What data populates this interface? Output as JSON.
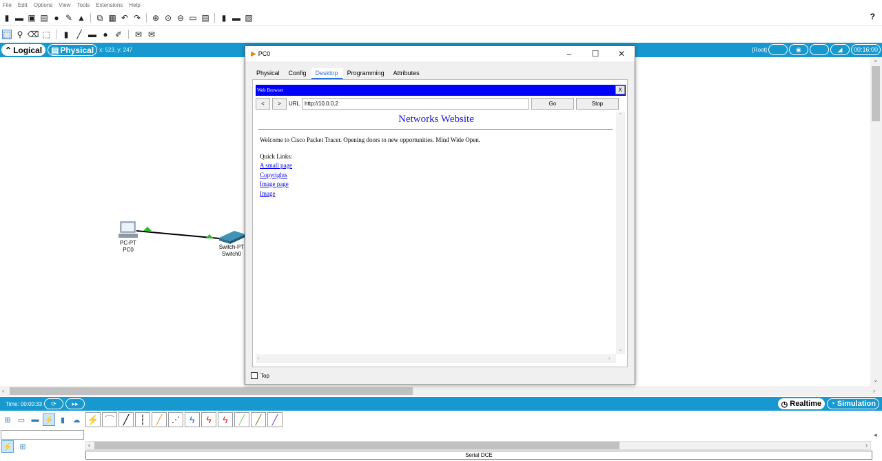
{
  "menu": [
    "File",
    "Edit",
    "Options",
    "View",
    "Tools",
    "Extensions",
    "Help"
  ],
  "help_label": "?",
  "topbar": {
    "logical_label": "Logical",
    "physical_label": "Physical",
    "coords": "x: 523, y: 247",
    "root_label": "[Root]",
    "clock": "00:16:00"
  },
  "devices": [
    {
      "type": "PC-PT",
      "name": "PC0"
    },
    {
      "type": "Switch-PT",
      "name": "Switch0"
    }
  ],
  "bottombar": {
    "time": "Time: 00:00:33",
    "realtime_label": "Realtime",
    "simulation_label": "Simulation"
  },
  "status_field": "Serial DCE",
  "dialog": {
    "title": "PC0",
    "tabs": [
      "Physical",
      "Config",
      "Desktop",
      "Programming",
      "Attributes"
    ],
    "active_tab": "Desktop",
    "browser": {
      "title": "Web Browser",
      "close_label": "X",
      "back_label": "<",
      "forward_label": ">",
      "url_label": "URL",
      "url_value": "http://10.0.0.2",
      "go_label": "Go",
      "stop_label": "Stop",
      "heading": "Networks Website",
      "welcome": "Welcome to Cisco Packet Tracer. Opening doors to new opportunities. Mind Wide Open.",
      "quick_links_title": "Quick Links:",
      "links": [
        "A small page",
        "Copyrights",
        "Image page",
        "Image"
      ]
    },
    "top_checkbox_label": "Top"
  },
  "colors": {
    "accent": "#1798cf",
    "browser_title": "#0000ff",
    "heading": "#1a1ad4",
    "link": "#0000ee"
  }
}
